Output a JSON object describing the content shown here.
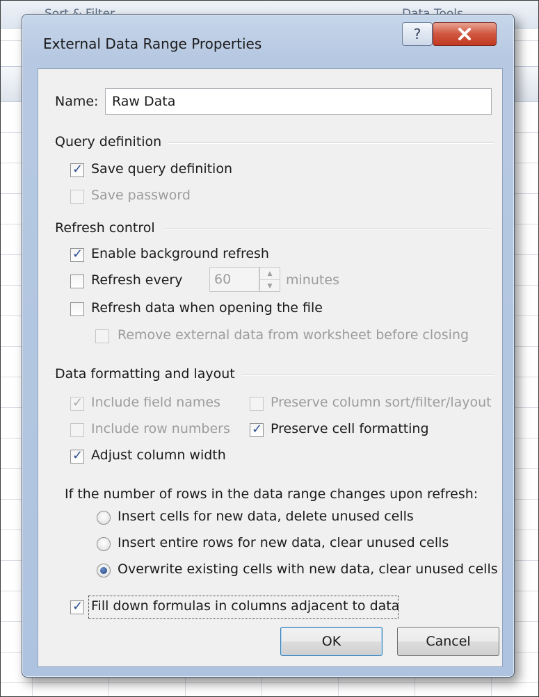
{
  "background": {
    "ribbon_left": "Sort & Filter",
    "ribbon_right": "Data Tools"
  },
  "dialog": {
    "title": "External Data Range Properties",
    "help_symbol": "?",
    "close_symbol": "✕"
  },
  "name_field": {
    "label": "Name:",
    "value": "Raw Data"
  },
  "query_definition": {
    "title": "Query definition",
    "save_query_definition": {
      "label": "Save query definition",
      "checked": true,
      "enabled": true
    },
    "save_password": {
      "label": "Save password",
      "checked": false,
      "enabled": false
    }
  },
  "refresh_control": {
    "title": "Refresh control",
    "enable_background_refresh": {
      "label": "Enable background refresh",
      "checked": true
    },
    "refresh_every": {
      "label": "Refresh every",
      "checked": false,
      "value": "60",
      "unit": "minutes"
    },
    "refresh_on_open": {
      "label": "Refresh data when opening the file",
      "checked": false
    },
    "remove_external_data": {
      "label": "Remove external data from worksheet before closing",
      "checked": false,
      "enabled": false
    }
  },
  "data_formatting": {
    "title": "Data formatting and layout",
    "include_field_names": {
      "label": "Include field names",
      "checked": true,
      "enabled": false
    },
    "include_row_numbers": {
      "label": "Include row numbers",
      "checked": false,
      "enabled": false
    },
    "adjust_column_width": {
      "label": "Adjust column width",
      "checked": true
    },
    "preserve_sort_filter": {
      "label": "Preserve column sort/filter/layout",
      "checked": false,
      "enabled": false
    },
    "preserve_cell_formatting": {
      "label": "Preserve cell formatting",
      "checked": true
    }
  },
  "rows_change": {
    "prompt": "If the number of rows in the data range changes upon refresh:",
    "options": [
      {
        "label": "Insert cells for new data, delete unused cells",
        "selected": false
      },
      {
        "label": "Insert entire rows for new data, clear unused cells",
        "selected": false
      },
      {
        "label": "Overwrite existing cells with new data, clear unused cells",
        "selected": true
      }
    ]
  },
  "fill_down": {
    "label": "Fill down formulas in columns adjacent to data",
    "checked": true
  },
  "buttons": {
    "ok": "OK",
    "cancel": "Cancel"
  }
}
